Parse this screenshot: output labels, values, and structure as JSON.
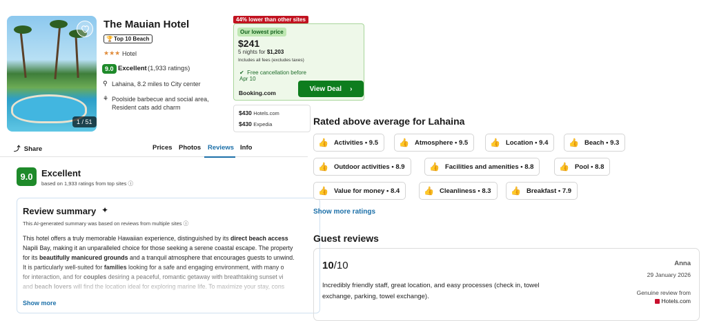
{
  "hotel": {
    "name": "The Mauian Hotel",
    "badge": "Top 10 Beach",
    "stars": "★★★",
    "type": "Hotel",
    "score": "9.0",
    "rating_word": "Excellent",
    "rating_count": "(1,933 ratings)",
    "location": "Lahaina, 8.2 miles to City center",
    "amenities": "Poolside barbecue and social area, Resident cats add charm",
    "photo_counter": "1 / 51"
  },
  "deal": {
    "badge": "44% lower than other sites",
    "lowest_label": "Our lowest price",
    "price": "$241",
    "nights_prefix": "5 nights for ",
    "nights_total": "$1,203",
    "fees": "Includes all fees (excludes taxes)",
    "cancellation": "Free cancellation before Apr 10",
    "provider": "Booking.com",
    "button": "View Deal",
    "alternatives": [
      {
        "price": "$430",
        "site": "Hotels.com"
      },
      {
        "price": "$430",
        "site": "Expedia"
      }
    ]
  },
  "tabs": {
    "share": "Share",
    "items": [
      "Prices",
      "Photos",
      "Reviews",
      "Info"
    ],
    "active": "Reviews"
  },
  "overall": {
    "score": "9.0",
    "word": "Excellent",
    "based_on": "based on 1,933 ratings from top sites"
  },
  "summary": {
    "title": "Review summary",
    "subtitle": "This AI-generated summary was based on reviews from multiple sites",
    "show_more": "Show more"
  },
  "ratings": {
    "title": "Rated above average for Lahaina",
    "items": [
      "Activities • 9.5",
      "Atmosphere • 9.5",
      "Location • 9.4",
      "Beach • 9.3",
      "Outdoor activities • 8.9",
      "Facilities and amenities • 8.8",
      "Pool • 8.8",
      "Value for money • 8.4",
      "Cleanliness • 8.3",
      "Breakfast • 7.9"
    ],
    "show_more": "Show more ratings"
  },
  "guest_reviews": {
    "title": "Guest reviews",
    "score": "10",
    "score_max": "/10",
    "text": "Incredibly friendly staff, great location, and easy processes (check in, towel exchange, parking, towel exchange).",
    "name": "Anna",
    "date": "29 January 2026",
    "genuine": "Genuine review from",
    "source": "Hotels.com"
  },
  "colors": {
    "green": "#1e8a2a",
    "link_blue": "#1b6fa8",
    "deal_red": "#c1121f"
  }
}
